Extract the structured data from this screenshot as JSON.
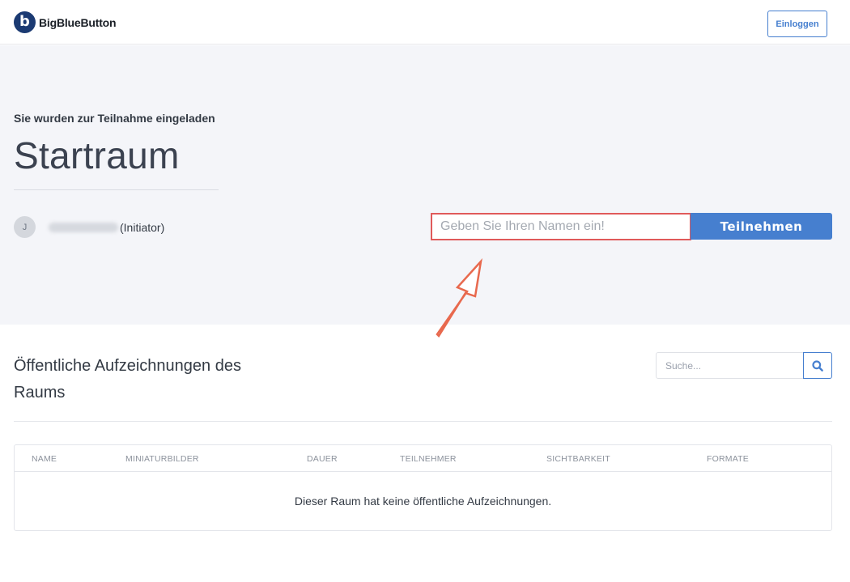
{
  "header": {
    "logo_text": "BigBlueButton",
    "logo_mark": "b",
    "login_label": "Einloggen"
  },
  "hero": {
    "invite_text": "Sie wurden zur Teilnahme eingeladen",
    "room_title": "Startraum",
    "owner": {
      "avatar_initial": "J",
      "role": "(Initiator)"
    },
    "name_placeholder": "Geben Sie Ihren Namen ein!",
    "join_label": "Teilnehmen"
  },
  "recordings": {
    "title": "Öffentliche Aufzeichnungen des Raums",
    "search_placeholder": "Suche...",
    "columns": [
      "Name",
      "Miniaturbilder",
      "Dauer",
      "Teilnehmer",
      "Sichtbarkeit",
      "Formate"
    ],
    "empty_message": "Dieser Raum hat keine öffentliche Aufzeichnungen."
  },
  "colors": {
    "accent": "#467fcf",
    "highlight": "#e05a5a",
    "hero_bg": "#f4f5f9"
  }
}
